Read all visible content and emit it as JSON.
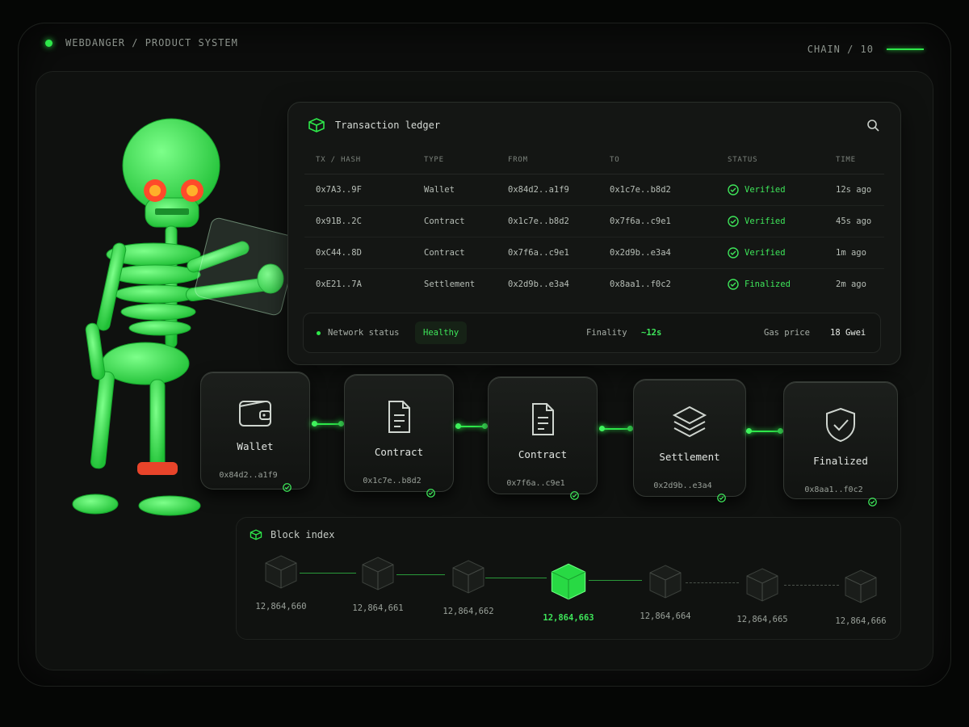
{
  "topbar": {
    "breadcrumb": "WEBDANGER / PRODUCT SYSTEM",
    "chain": "CHAIN / 10"
  },
  "ledger": {
    "title": "Transaction ledger",
    "columns": [
      "TX / HASH",
      "TYPE",
      "FROM",
      "TO",
      "STATUS",
      "TIME"
    ],
    "rows": [
      {
        "tx": "0x7A3..9F",
        "type": "Wallet",
        "from": "0x84d2..a1f9",
        "to": "0x1c7e..b8d2",
        "status": "Verified",
        "time": "12s ago"
      },
      {
        "tx": "0x91B..2C",
        "type": "Contract",
        "from": "0x1c7e..b8d2",
        "to": "0x7f6a..c9e1",
        "status": "Verified",
        "time": "45s ago"
      },
      {
        "tx": "0xC44..8D",
        "type": "Contract",
        "from": "0x7f6a..c9e1",
        "to": "0x2d9b..e3a4",
        "status": "Verified",
        "time": "1m ago"
      },
      {
        "tx": "0xE21..7A",
        "type": "Settlement",
        "from": "0x2d9b..e3a4",
        "to": "0x8aa1..f0c2",
        "status": "Finalized",
        "time": "2m ago"
      }
    ],
    "network": {
      "label": "Network status",
      "health": "Healthy",
      "finality_label": "Finality",
      "finality": "~12s",
      "gas_label": "Gas price",
      "gas": "18 Gwei"
    }
  },
  "flow": [
    {
      "label": "Wallet",
      "hash": "0x84d2..a1f9",
      "icon": "wallet-icon"
    },
    {
      "label": "Contract",
      "hash": "0x1c7e..b8d2",
      "icon": "document-icon"
    },
    {
      "label": "Contract",
      "hash": "0x7f6a..c9e1",
      "icon": "document-icon"
    },
    {
      "label": "Settlement",
      "hash": "0x2d9b..e3a4",
      "icon": "layers-icon"
    },
    {
      "label": "Finalized",
      "hash": "0x8aa1..f0c2",
      "icon": "shield-check-icon"
    }
  ],
  "blocks": {
    "title": "Block index",
    "items": [
      "12,864,660",
      "12,864,661",
      "12,864,662",
      "12,864,663",
      "12,864,664",
      "12,864,665",
      "12,864,666"
    ],
    "active_index": 3
  },
  "colors": {
    "accent": "#2ee84a",
    "background": "#0c0d0c",
    "eye": "#ff4a2a"
  }
}
